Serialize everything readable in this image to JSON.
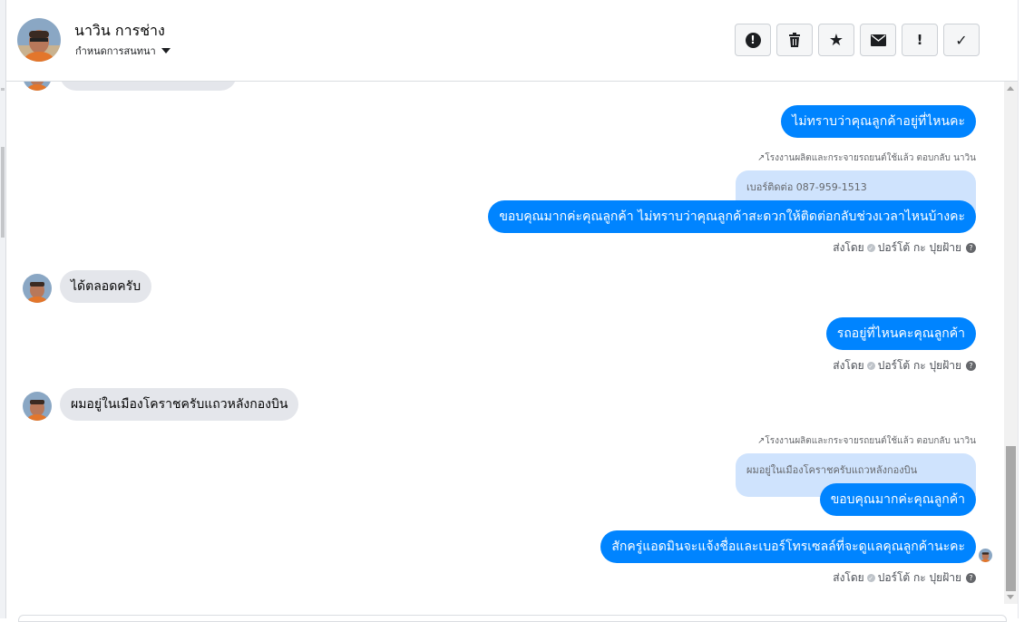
{
  "header": {
    "contact_name": "นาวิน การช่าง",
    "assign_label": "กำหนดการสนทนา",
    "tools": [
      {
        "icon": "alert-circle-icon",
        "glyph": "!"
      },
      {
        "icon": "trash-icon",
        "glyph": "🗑"
      },
      {
        "icon": "star-icon",
        "glyph": "★"
      },
      {
        "icon": "envelope-icon",
        "glyph": "✉"
      },
      {
        "icon": "exclamation-icon",
        "glyph": "!"
      },
      {
        "icon": "checkmark-icon",
        "glyph": "✓"
      }
    ]
  },
  "messages": {
    "out1": "ไม่ทราบว่าคุณลูกค้าอยู่ที่ไหนคะ",
    "reply1_meta": "↗โรงงานผลิตและกระจายรถยนต์ใช้แล้ว ตอบกลับ นาวิน",
    "reply1_quote": "เบอร์ติดต่อ 087-959-1513",
    "out2": "ขอบคุณมากค่ะคุณลูกค้า ไม่ทราบว่าคุณลูกค้าสะดวกให้ติดต่อกลับช่วงเวลาไหนบ้างคะ",
    "in1": "ได้ตลอดครับ",
    "out3": "รถอยู่ที่ไหนคะคุณลูกค้า",
    "in2": "ผมอยู่ในเมืองโคราชครับแถวหลังกองบิน",
    "reply2_meta": "↗โรงงานผลิตและกระจายรถยนต์ใช้แล้ว ตอบกลับ นาวิน",
    "reply2_quote": "ผมอยู่ในเมืองโคราชครับแถวหลังกองบิน",
    "out4": "ขอบคุณมากค่ะคุณลูกค้า",
    "out5": "สักครู่แอดมินจะแจ้งชื่อและเบอร์โทรเซลล์ที่จะดูแลคุณลูกค้านะคะ"
  },
  "sent_by": {
    "prefix": "ส่งโดย",
    "agent": "ปอร์โต้ กะ ปุยฝ้าย"
  },
  "colors": {
    "accent": "#0084ff",
    "incoming": "#e4e6eb",
    "quote": "#cfe3fd"
  }
}
